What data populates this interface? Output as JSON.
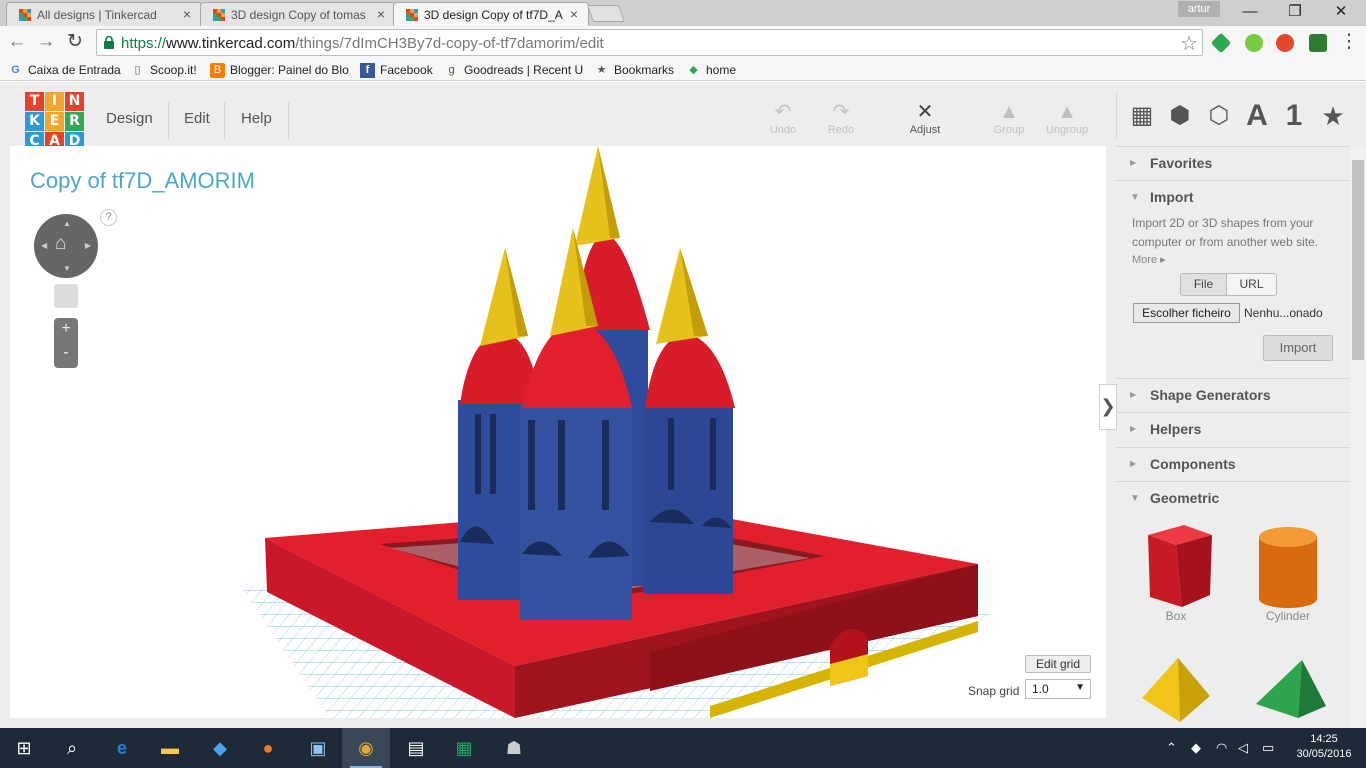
{
  "browser": {
    "tabs": [
      {
        "title": "All designs | Tinkercad",
        "active": false
      },
      {
        "title": "3D design Copy of tomas",
        "active": false
      },
      {
        "title": "3D design Copy of tf7D_A",
        "active": true
      }
    ],
    "profile_name": "artur",
    "window_controls": {
      "minimize": "—",
      "maximize": "❐",
      "close": "✕"
    },
    "url": {
      "scheme": "https://",
      "host": "www.tinkercad.com",
      "path": "/things/7dImCH3By7d-copy-of-tf7damorim/edit"
    },
    "nav": {
      "back": "←",
      "forward": "→",
      "reload": "↻",
      "star": "☆",
      "menu": "⋮"
    },
    "bookmarks": [
      {
        "label": "Caixa de Entrada",
        "icon": "google-icon",
        "glyph": "G"
      },
      {
        "label": "Scoop.it!",
        "icon": "page-icon",
        "glyph": "▯"
      },
      {
        "label": "Blogger: Painel do Blo",
        "icon": "blogger-icon",
        "glyph": "B"
      },
      {
        "label": "Facebook",
        "icon": "facebook-icon",
        "glyph": "f"
      },
      {
        "label": "Goodreads | Recent U",
        "icon": "goodreads-icon",
        "glyph": "g"
      },
      {
        "label": "Bookmarks",
        "icon": "star-icon",
        "glyph": "★"
      },
      {
        "label": "home",
        "icon": "feedly-icon",
        "glyph": "◆"
      }
    ]
  },
  "app": {
    "logo_letters": [
      "T",
      "I",
      "N",
      "K",
      "E",
      "R",
      "C",
      "A",
      "D"
    ],
    "logo_colors": [
      "#e5412d",
      "#f2a62b",
      "#e5412d",
      "#2b9bd6",
      "#f2a62b",
      "#35a853",
      "#2b9bd6",
      "#e5412d",
      "#2b9bd6"
    ],
    "menu": [
      "Design",
      "Edit",
      "Help"
    ],
    "tools": [
      {
        "label": "Undo",
        "icon": "undo-icon",
        "glyph": "↶",
        "enabled": false
      },
      {
        "label": "Redo",
        "icon": "redo-icon",
        "glyph": "↷",
        "enabled": false
      },
      {
        "label": "Adjust",
        "icon": "adjust-icon",
        "glyph": "✕",
        "enabled": true
      },
      {
        "label": "Group",
        "icon": "group-icon",
        "glyph": "▲",
        "enabled": false
      },
      {
        "label": "Ungroup",
        "icon": "ungroup-icon",
        "glyph": "▲",
        "enabled": false
      }
    ],
    "view_icons": [
      {
        "name": "grid-view-icon",
        "glyph": "▦"
      },
      {
        "name": "cube-view-icon",
        "glyph": "⬢"
      },
      {
        "name": "wireframe-view-icon",
        "glyph": "⬡"
      },
      {
        "name": "text-shapes-icon",
        "glyph": "A"
      },
      {
        "name": "number-shapes-icon",
        "glyph": "1"
      },
      {
        "name": "favorites-star-icon",
        "glyph": "★"
      }
    ],
    "design_title": "Copy of tf7D_AMORIM",
    "help": "?",
    "zoom_in": "+",
    "zoom_out": "-",
    "edit_grid": "Edit grid",
    "snap_grid_label": "Snap grid",
    "snap_grid_value": "1.0",
    "collapse_glyph": "❯"
  },
  "sidebar": {
    "sections": [
      {
        "label": "Favorites",
        "open": false
      },
      {
        "label": "Import",
        "open": true
      },
      {
        "label": "Shape Generators",
        "open": false
      },
      {
        "label": "Helpers",
        "open": false
      },
      {
        "label": "Components",
        "open": false
      },
      {
        "label": "Geometric",
        "open": true
      }
    ],
    "import_description": "Import 2D or 3D shapes from your computer or from another web site.",
    "more_link": "More ▸",
    "source_tabs": [
      "File",
      "URL"
    ],
    "choose_file_button": "Escolher ficheiro",
    "no_file_text": "Nenhu...onado",
    "import_button": "Import",
    "shapes": [
      {
        "label": "Box",
        "color": "#d0202e"
      },
      {
        "label": "Cylinder",
        "color": "#e67e22"
      },
      {
        "label": "",
        "color": "#f1c40f"
      },
      {
        "label": "",
        "color": "#2ea44f"
      }
    ]
  },
  "taskbar": {
    "clock_time": "14:25",
    "clock_date": "30/05/2016"
  }
}
